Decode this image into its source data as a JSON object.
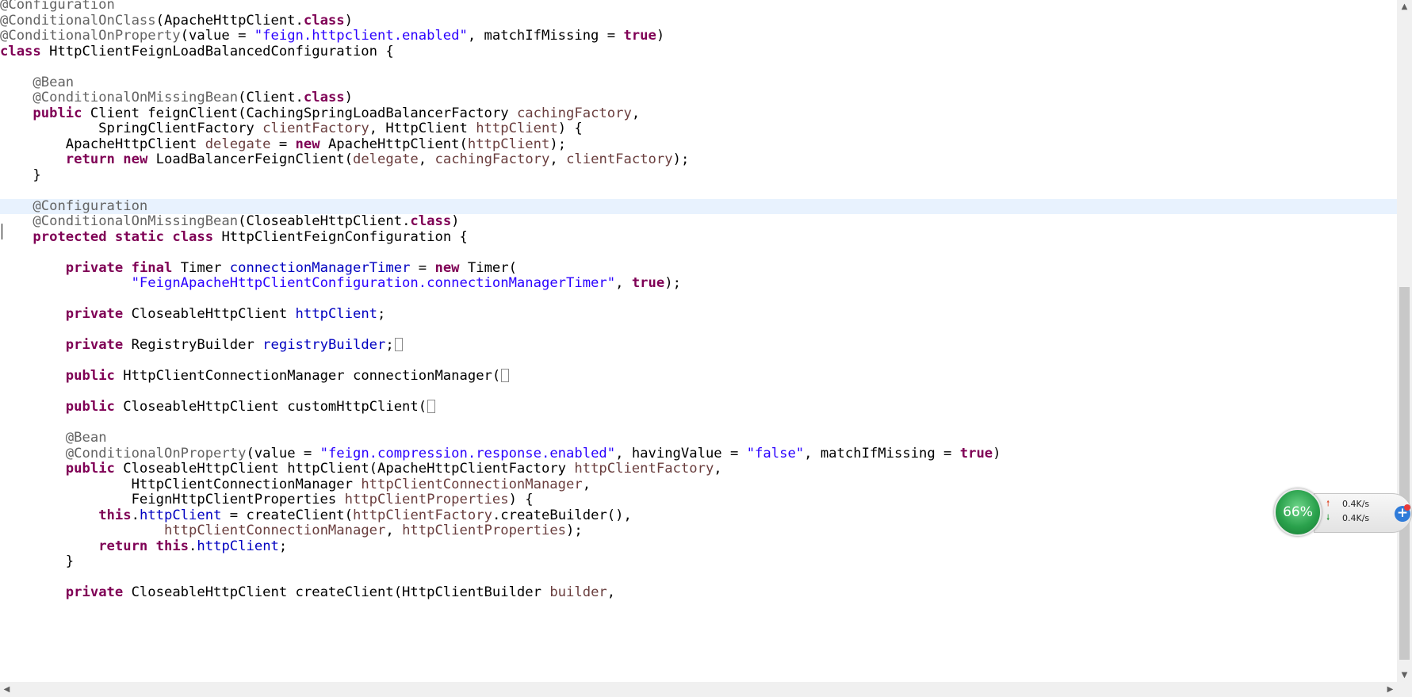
{
  "editor": {
    "current_line_index": 13,
    "lines": [
      [
        [
          "ann",
          "@Configuration"
        ]
      ],
      [
        [
          "ann",
          "@ConditionalOnClass"
        ],
        [
          "plain",
          "(ApacheHttpClient."
        ],
        [
          "kw",
          "class"
        ],
        [
          "plain",
          ")"
        ]
      ],
      [
        [
          "ann",
          "@ConditionalOnProperty"
        ],
        [
          "plain",
          "(value = "
        ],
        [
          "str",
          "\"feign.httpclient.enabled\""
        ],
        [
          "plain",
          ", matchIfMissing = "
        ],
        [
          "kw",
          "true"
        ],
        [
          "plain",
          ")"
        ]
      ],
      [
        [
          "kw",
          "class"
        ],
        [
          "plain",
          " HttpClientFeignLoadBalancedConfiguration {"
        ]
      ],
      [],
      [
        [
          "plain",
          "    "
        ],
        [
          "ann",
          "@Bean"
        ]
      ],
      [
        [
          "plain",
          "    "
        ],
        [
          "ann",
          "@ConditionalOnMissingBean"
        ],
        [
          "plain",
          "(Client."
        ],
        [
          "kw",
          "class"
        ],
        [
          "plain",
          ")"
        ]
      ],
      [
        [
          "plain",
          "    "
        ],
        [
          "kw",
          "public"
        ],
        [
          "plain",
          " Client feignClient(CachingSpringLoadBalancerFactory "
        ],
        [
          "var",
          "cachingFactory"
        ],
        [
          "plain",
          ","
        ]
      ],
      [
        [
          "plain",
          "            SpringClientFactory "
        ],
        [
          "var",
          "clientFactory"
        ],
        [
          "plain",
          ", HttpClient "
        ],
        [
          "var",
          "httpClient"
        ],
        [
          "plain",
          ") {"
        ]
      ],
      [
        [
          "plain",
          "        ApacheHttpClient "
        ],
        [
          "var",
          "delegate"
        ],
        [
          "plain",
          " = "
        ],
        [
          "kw",
          "new"
        ],
        [
          "plain",
          " ApacheHttpClient("
        ],
        [
          "var",
          "httpClient"
        ],
        [
          "plain",
          ");"
        ]
      ],
      [
        [
          "plain",
          "        "
        ],
        [
          "kw",
          "return"
        ],
        [
          "plain",
          " "
        ],
        [
          "kw",
          "new"
        ],
        [
          "plain",
          " LoadBalancerFeignClient("
        ],
        [
          "var",
          "delegate"
        ],
        [
          "plain",
          ", "
        ],
        [
          "var",
          "cachingFactory"
        ],
        [
          "plain",
          ", "
        ],
        [
          "var",
          "clientFactory"
        ],
        [
          "plain",
          ");"
        ]
      ],
      [
        [
          "plain",
          "    }"
        ]
      ],
      [],
      [
        [
          "plain",
          "    "
        ],
        [
          "ann",
          "@Configuration"
        ]
      ],
      [
        [
          "plain",
          "    "
        ],
        [
          "ann",
          "@ConditionalOnMissingBean"
        ],
        [
          "plain",
          "(CloseableHttpClient."
        ],
        [
          "kw",
          "class"
        ],
        [
          "plain",
          ")"
        ]
      ],
      [
        [
          "plain",
          "    "
        ],
        [
          "kw",
          "protected"
        ],
        [
          "plain",
          " "
        ],
        [
          "kw",
          "static"
        ],
        [
          "plain",
          " "
        ],
        [
          "kw",
          "class"
        ],
        [
          "plain",
          " HttpClientFeignConfiguration {"
        ]
      ],
      [],
      [
        [
          "plain",
          "        "
        ],
        [
          "kw",
          "private"
        ],
        [
          "plain",
          " "
        ],
        [
          "kw",
          "final"
        ],
        [
          "plain",
          " Timer "
        ],
        [
          "field",
          "connectionManagerTimer"
        ],
        [
          "plain",
          " = "
        ],
        [
          "kw",
          "new"
        ],
        [
          "plain",
          " Timer("
        ]
      ],
      [
        [
          "plain",
          "                "
        ],
        [
          "str",
          "\"FeignApacheHttpClientConfiguration.connectionManagerTimer\""
        ],
        [
          "plain",
          ", "
        ],
        [
          "kw",
          "true"
        ],
        [
          "plain",
          ");"
        ]
      ],
      [],
      [
        [
          "plain",
          "        "
        ],
        [
          "kw",
          "private"
        ],
        [
          "plain",
          " CloseableHttpClient "
        ],
        [
          "field",
          "httpClient"
        ],
        [
          "plain",
          ";"
        ]
      ],
      [],
      [
        [
          "plain",
          "        "
        ],
        [
          "kw",
          "private"
        ],
        [
          "plain",
          " RegistryBuilder "
        ],
        [
          "field",
          "registryBuilder"
        ],
        [
          "plain",
          ";"
        ],
        [
          "fold",
          ""
        ]
      ],
      [],
      [
        [
          "plain",
          "        "
        ],
        [
          "kw",
          "public"
        ],
        [
          "plain",
          " HttpClientConnectionManager connectionManager("
        ],
        [
          "fold",
          ""
        ]
      ],
      [],
      [
        [
          "plain",
          "        "
        ],
        [
          "kw",
          "public"
        ],
        [
          "plain",
          " CloseableHttpClient customHttpClient("
        ],
        [
          "fold",
          ""
        ]
      ],
      [],
      [
        [
          "plain",
          "        "
        ],
        [
          "ann",
          "@Bean"
        ]
      ],
      [
        [
          "plain",
          "        "
        ],
        [
          "ann",
          "@ConditionalOnProperty"
        ],
        [
          "plain",
          "(value = "
        ],
        [
          "str",
          "\"feign.compression.response.enabled\""
        ],
        [
          "plain",
          ", havingValue = "
        ],
        [
          "str",
          "\"false\""
        ],
        [
          "plain",
          ", matchIfMissing = "
        ],
        [
          "kw",
          "true"
        ],
        [
          "plain",
          ")"
        ]
      ],
      [
        [
          "plain",
          "        "
        ],
        [
          "kw",
          "public"
        ],
        [
          "plain",
          " CloseableHttpClient httpClient(ApacheHttpClientFactory "
        ],
        [
          "var",
          "httpClientFactory"
        ],
        [
          "plain",
          ","
        ]
      ],
      [
        [
          "plain",
          "                HttpClientConnectionManager "
        ],
        [
          "var",
          "httpClientConnectionManager"
        ],
        [
          "plain",
          ","
        ]
      ],
      [
        [
          "plain",
          "                FeignHttpClientProperties "
        ],
        [
          "var",
          "httpClientProperties"
        ],
        [
          "plain",
          ") {"
        ]
      ],
      [
        [
          "plain",
          "            "
        ],
        [
          "kw",
          "this"
        ],
        [
          "plain",
          "."
        ],
        [
          "field",
          "httpClient"
        ],
        [
          "plain",
          " = createClient("
        ],
        [
          "var",
          "httpClientFactory"
        ],
        [
          "plain",
          ".createBuilder(),"
        ]
      ],
      [
        [
          "plain",
          "                    "
        ],
        [
          "var",
          "httpClientConnectionManager"
        ],
        [
          "plain",
          ", "
        ],
        [
          "var",
          "httpClientProperties"
        ],
        [
          "plain",
          ");"
        ]
      ],
      [
        [
          "plain",
          "            "
        ],
        [
          "kw",
          "return"
        ],
        [
          "plain",
          " "
        ],
        [
          "kw",
          "this"
        ],
        [
          "plain",
          "."
        ],
        [
          "field",
          "httpClient"
        ],
        [
          "plain",
          ";"
        ]
      ],
      [
        [
          "plain",
          "        }"
        ]
      ],
      [],
      [
        [
          "plain",
          "        "
        ],
        [
          "kw",
          "private"
        ],
        [
          "plain",
          " CloseableHttpClient createClient(HttpClientBuilder "
        ],
        [
          "var",
          "builder"
        ],
        [
          "plain",
          ","
        ]
      ]
    ]
  },
  "scrollbars": {
    "up_arrow": "▲",
    "down_arrow": "▼",
    "left_arrow": "◀",
    "right_arrow": "▶"
  },
  "net_widget": {
    "cpu_percent": "66%",
    "upload_speed": "0.4K/s",
    "download_speed": "0.4K/s",
    "upload_icon": "arrow-up-icon",
    "download_icon": "arrow-down-icon",
    "plus_label": "+"
  },
  "colors": {
    "keyword": "#7f0055",
    "annotation": "#646464",
    "string": "#2a00ff",
    "field": "#0000c0",
    "local_variable": "#6a3e3e",
    "current_line": "#e8f2fe"
  }
}
